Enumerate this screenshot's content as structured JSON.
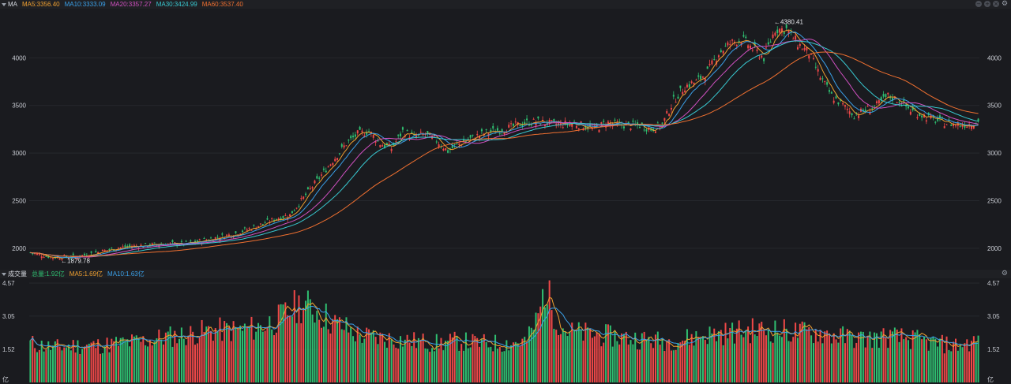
{
  "header": {
    "indicator_label": "MA",
    "ma_items": [
      {
        "text": "MA5:3356.40",
        "color": "#f0a030"
      },
      {
        "text": "MA10:3333.09",
        "color": "#3aa0e8"
      },
      {
        "text": "MA20:3357.27",
        "color": "#d050c0"
      },
      {
        "text": "MA30:3424.99",
        "color": "#38c8d0"
      },
      {
        "text": "MA60:3537.40",
        "color": "#f07030"
      }
    ]
  },
  "volume_header": {
    "label": "成交量",
    "items": [
      {
        "text": "总量:1.92亿",
        "color": "#2fbf71"
      },
      {
        "text": "MA5:1.69亿",
        "color": "#f0a030"
      },
      {
        "text": "MA10:1.63亿",
        "color": "#3aa0e8"
      }
    ],
    "unit": "亿"
  },
  "colors": {
    "up": "#f04848",
    "down": "#2fbf71",
    "grid": "#26282d"
  },
  "chart_data": [
    {
      "type": "candlestick",
      "ylim": [
        1850,
        4450
      ],
      "yticks": [
        2000,
        2500,
        3000,
        3500,
        4000
      ],
      "annotations": [
        {
          "text": "←1879.78",
          "value": 1879.78
        },
        {
          "text": "←4380.41",
          "value": 4380.41
        }
      ],
      "series_anchor_closes": [
        [
          0,
          1955
        ],
        [
          10,
          1905
        ],
        [
          20,
          1910
        ],
        [
          30,
          1960
        ],
        [
          40,
          2010
        ],
        [
          50,
          2030
        ],
        [
          60,
          2045
        ],
        [
          70,
          2050
        ],
        [
          80,
          2100
        ],
        [
          90,
          2150
        ],
        [
          100,
          2230
        ],
        [
          110,
          2320
        ],
        [
          115,
          2350
        ],
        [
          120,
          2500
        ],
        [
          125,
          2650
        ],
        [
          130,
          2800
        ],
        [
          135,
          2950
        ],
        [
          140,
          3100
        ],
        [
          145,
          3200
        ],
        [
          150,
          3230
        ],
        [
          155,
          3100
        ],
        [
          160,
          3050
        ],
        [
          165,
          3230
        ],
        [
          170,
          3170
        ],
        [
          175,
          3200
        ],
        [
          180,
          3130
        ],
        [
          185,
          3020
        ],
        [
          190,
          3100
        ],
        [
          195,
          3150
        ],
        [
          200,
          3200
        ],
        [
          205,
          3230
        ],
        [
          210,
          3250
        ],
        [
          215,
          3290
        ],
        [
          220,
          3320
        ],
        [
          225,
          3330
        ],
        [
          230,
          3310
        ],
        [
          235,
          3300
        ],
        [
          240,
          3310
        ],
        [
          245,
          3290
        ],
        [
          250,
          3250
        ],
        [
          255,
          3320
        ],
        [
          260,
          3300
        ],
        [
          265,
          3290
        ],
        [
          270,
          3290
        ],
        [
          275,
          3250
        ],
        [
          280,
          3300
        ],
        [
          285,
          3550
        ],
        [
          290,
          3700
        ],
        [
          295,
          3750
        ],
        [
          300,
          3850
        ],
        [
          305,
          4050
        ],
        [
          310,
          4150
        ],
        [
          315,
          4200
        ],
        [
          320,
          4100
        ],
        [
          325,
          4000
        ],
        [
          330,
          4300
        ],
        [
          335,
          4300
        ],
        [
          340,
          4150
        ],
        [
          345,
          4050
        ],
        [
          350,
          3800
        ],
        [
          355,
          3600
        ],
        [
          360,
          3500
        ],
        [
          365,
          3400
        ],
        [
          370,
          3450
        ],
        [
          375,
          3500
        ],
        [
          380,
          3600
        ],
        [
          385,
          3550
        ],
        [
          390,
          3450
        ],
        [
          395,
          3400
        ],
        [
          400,
          3350
        ],
        [
          405,
          3320
        ],
        [
          410,
          3300
        ],
        [
          415,
          3300
        ],
        [
          420,
          3330
        ]
      ]
    },
    {
      "type": "bar",
      "ylim": [
        0,
        4.57
      ],
      "yticks": [
        1.52,
        3.05,
        4.57
      ],
      "series_anchor_values": [
        [
          0,
          1.8
        ],
        [
          10,
          1.6
        ],
        [
          20,
          1.7
        ],
        [
          30,
          1.7
        ],
        [
          40,
          1.8
        ],
        [
          50,
          1.9
        ],
        [
          60,
          2.1
        ],
        [
          70,
          2.2
        ],
        [
          80,
          2.4
        ],
        [
          90,
          2.4
        ],
        [
          100,
          2.5
        ],
        [
          110,
          2.9
        ],
        [
          115,
          3.3
        ],
        [
          120,
          3.6
        ],
        [
          125,
          3.4
        ],
        [
          130,
          3.1
        ],
        [
          135,
          2.7
        ],
        [
          140,
          2.5
        ],
        [
          145,
          2.2
        ],
        [
          150,
          2.1
        ],
        [
          160,
          2.0
        ],
        [
          170,
          1.9
        ],
        [
          180,
          1.8
        ],
        [
          190,
          1.9
        ],
        [
          200,
          1.8
        ],
        [
          210,
          1.8
        ],
        [
          220,
          1.9
        ],
        [
          225,
          3.0
        ],
        [
          228,
          4.4
        ],
        [
          231,
          3.5
        ],
        [
          235,
          2.6
        ],
        [
          240,
          2.3
        ],
        [
          250,
          2.2
        ],
        [
          260,
          2.1
        ],
        [
          270,
          2.0
        ],
        [
          280,
          1.9
        ],
        [
          290,
          2.0
        ],
        [
          300,
          2.2
        ],
        [
          310,
          2.3
        ],
        [
          320,
          2.4
        ],
        [
          330,
          2.4
        ],
        [
          340,
          2.3
        ],
        [
          350,
          2.3
        ],
        [
          360,
          2.1
        ],
        [
          370,
          2.0
        ],
        [
          380,
          2.1
        ],
        [
          390,
          2.0
        ],
        [
          400,
          1.8
        ],
        [
          410,
          1.7
        ],
        [
          420,
          1.9
        ]
      ]
    }
  ]
}
